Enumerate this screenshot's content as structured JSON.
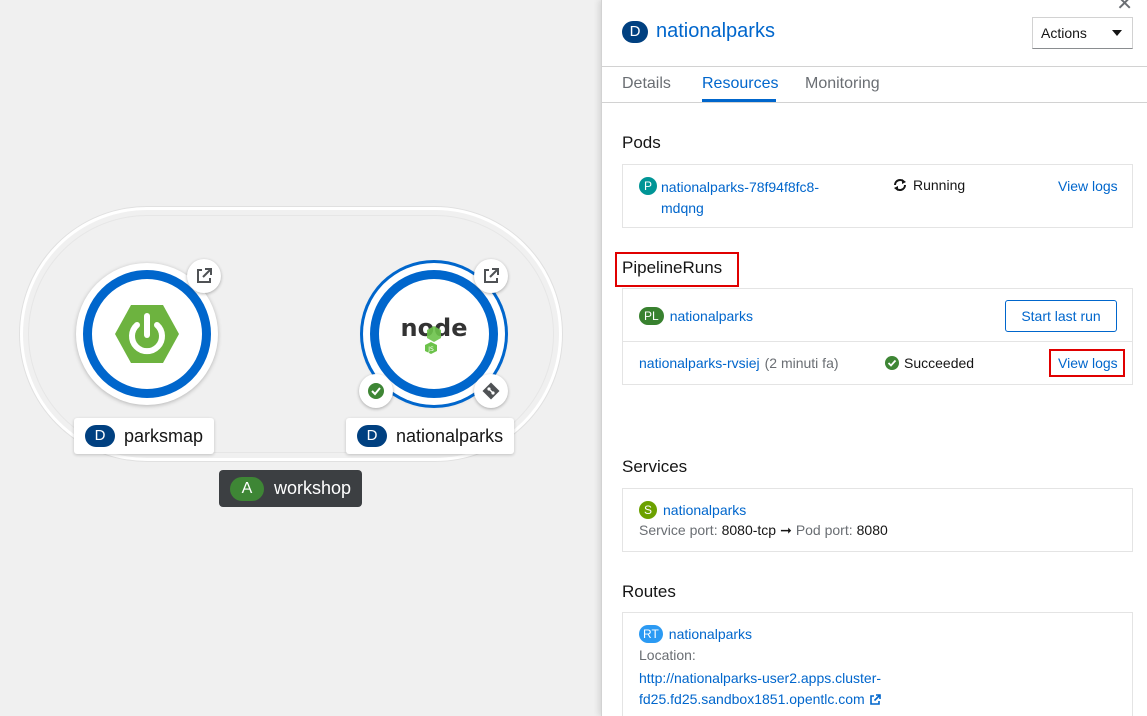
{
  "topology": {
    "nodes": [
      {
        "kind_badge": "D",
        "name": "parksmap",
        "icon": "spring-boot-icon"
      },
      {
        "kind_badge": "D",
        "name": "nationalparks",
        "icon": "nodejs-icon",
        "node_logo_text": "node"
      }
    ],
    "application_group": {
      "kind_badge": "A",
      "name": "workshop"
    }
  },
  "panel": {
    "kind_badge": "D",
    "title": "nationalparks",
    "actions_label": "Actions",
    "tabs": [
      "Details",
      "Resources",
      "Monitoring"
    ],
    "active_tab": "Resources",
    "pods": {
      "section_title": "Pods",
      "badge": "P",
      "name_line1": "nationalparks-78f94f8fc8-",
      "name_line2": "mdqng",
      "status": "Running",
      "view_logs": "View logs"
    },
    "pipeline_runs": {
      "section_title": "PipelineRuns",
      "pipeline_badge": "PL",
      "pipeline_name": "nationalparks",
      "start_last_run": "Start last run",
      "run_name": "nationalparks-rvsiej",
      "run_age": "(2 minuti fa)",
      "run_status": "Succeeded",
      "view_logs": "View logs"
    },
    "services": {
      "section_title": "Services",
      "badge": "S",
      "name": "nationalparks",
      "service_port_label": "Service port:",
      "service_port": "8080-tcp",
      "arrow": "➞",
      "pod_port_label": "Pod port:",
      "pod_port": "8080"
    },
    "routes": {
      "section_title": "Routes",
      "badge": "RT",
      "name": "nationalparks",
      "location_label": "Location:",
      "url_line1": "http://nationalparks-user2.apps.cluster-",
      "url_line2": "fd25.fd25.sandbox1851.opentlc.com"
    }
  },
  "colors": {
    "accent": "#0066cc",
    "highlight": "#e00000",
    "success": "#3e8635",
    "spring_green": "#6db33f"
  }
}
